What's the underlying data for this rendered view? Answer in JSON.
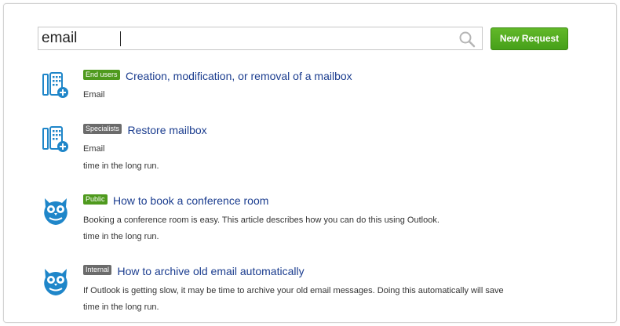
{
  "search": {
    "value": "email",
    "placeholder": ""
  },
  "toolbar": {
    "new_request_label": "New Request"
  },
  "results": [
    {
      "icon": "phone-add-icon",
      "badge": "End users",
      "badge_color": "#4f9a1e",
      "title": "Creation, modification, or removal of a mailbox",
      "lines": [
        "Email"
      ]
    },
    {
      "icon": "phone-add-icon",
      "badge": "Specialists",
      "badge_color": "#6b6b6b",
      "title": "Restore mailbox",
      "lines": [
        "Email",
        "time in the long run."
      ]
    },
    {
      "icon": "owl-icon",
      "badge": "Public",
      "badge_color": "#4f9a1e",
      "title": "How to book a conference room",
      "lines": [
        "Booking a conference room is easy. This article describes how you can do this using Outlook.",
        "time in the long run."
      ]
    },
    {
      "icon": "owl-icon",
      "badge": "Internal",
      "badge_color": "#6b6b6b",
      "title": "How to archive old email automatically",
      "lines": [
        "If Outlook is getting slow, it may be time to archive your old email messages. Doing this automatically will save",
        "time in the long run."
      ]
    }
  ],
  "colors": {
    "accent_green": "#4f9a1e",
    "link_blue": "#1b3d8f",
    "icon_blue": "#1f86c9"
  }
}
